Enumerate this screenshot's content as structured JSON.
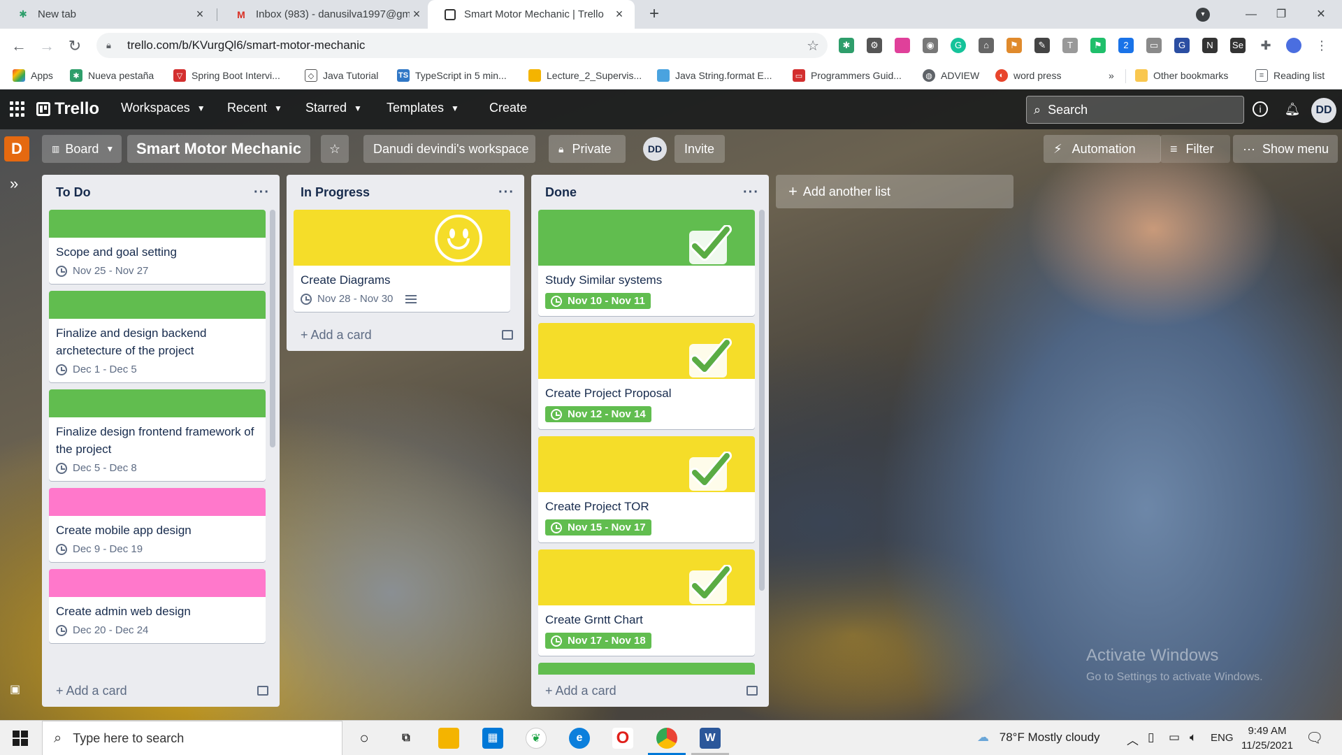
{
  "browser": {
    "tabs": [
      {
        "label": "New tab",
        "icon": "trello-favicon"
      },
      {
        "label": "Inbox (983) - danusilva1997@gm",
        "icon": "gmail-favicon"
      },
      {
        "label": "Smart Motor Mechanic | Trello",
        "icon": "trello-favicon",
        "active": true
      }
    ],
    "url": "trello.com/b/KVurgQl6/smart-motor-mechanic",
    "bookmarks": [
      "Apps",
      "Nueva pestaña",
      "Spring Boot Intervi...",
      "Java Tutorial",
      "TypeScript in 5 min...",
      "Lecture_2_Supervis...",
      "Java String.format E...",
      "Programmers Guid...",
      "ADVIEW",
      "word press"
    ],
    "bookmarks_overflow": "»",
    "other_bookmarks": "Other bookmarks",
    "reading_list": "Reading list"
  },
  "trello": {
    "logo": "Trello",
    "nav": [
      "Workspaces",
      "Recent",
      "Starred",
      "Templates"
    ],
    "create": "Create",
    "search_placeholder": "Search",
    "user_initials": "DD",
    "board": {
      "workspace_badge": "D",
      "view": "Board",
      "title": "Smart Motor Mechanic",
      "workspace": "Danudi devindi's workspace",
      "visibility": "Private",
      "member_initials": "DD",
      "invite": "Invite",
      "automation": "Automation",
      "filter": "Filter",
      "show_menu": "Show menu"
    },
    "lists": [
      {
        "title": "To Do",
        "add_card": "Add a card",
        "cards": [
          {
            "cover": "#61bd4f",
            "title": "Scope and goal setting",
            "dates": "Nov 25 - Nov 27"
          },
          {
            "cover": "#61bd4f",
            "title": "Finalize and design backend archetecture of the project",
            "dates": "Dec 1 - Dec 5"
          },
          {
            "cover": "#61bd4f",
            "title": "Finalize design frontend framework of the project",
            "dates": "Dec 5 - Dec 8"
          },
          {
            "cover": "#ff78cb",
            "title": "Create mobile app design",
            "dates": "Dec 9 - Dec 19"
          },
          {
            "cover": "#ff78cb",
            "title": "Create admin web design",
            "dates": "Dec 20 - Dec 24"
          }
        ]
      },
      {
        "title": "In Progress",
        "add_card": "Add a card",
        "cards": [
          {
            "cover": "#f5dd29",
            "sticker": "smiley",
            "title": "Create Diagrams",
            "dates": "Nov 28 - Nov 30",
            "has_description": true
          }
        ]
      },
      {
        "title": "Done",
        "add_card": "Add a card",
        "cards": [
          {
            "cover": "#61bd4f",
            "sticker": "check",
            "title": "Study Similar systems",
            "dates": "Nov 10 - Nov 11",
            "complete": true
          },
          {
            "cover": "#f5dd29",
            "sticker": "check",
            "title": "Create Project Proposal",
            "dates": "Nov 12 - Nov 14",
            "complete": true
          },
          {
            "cover": "#f5dd29",
            "sticker": "check",
            "title": "Create Project TOR",
            "dates": "Nov 15 - Nov 17",
            "complete": true
          },
          {
            "cover": "#f5dd29",
            "sticker": "check",
            "title": "Create Grntt Chart",
            "dates": "Nov 17 - Nov 18",
            "complete": true
          }
        ]
      }
    ],
    "add_list": "Add another list"
  },
  "watermark": {
    "line1": "Activate Windows",
    "line2": "Go to Settings to activate Windows."
  },
  "taskbar": {
    "search_placeholder": "Type here to search",
    "weather": "78°F  Mostly cloudy",
    "language": "ENG",
    "time": "9:49 AM",
    "date": "11/25/2021"
  }
}
